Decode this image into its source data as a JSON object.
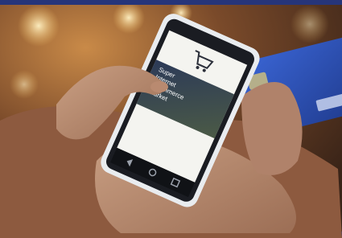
{
  "photo": {
    "subject": "hand-holding-smartphone-with-credit-card",
    "colors": {
      "background_warm": "#a0683a",
      "background_dark": "#3a2418",
      "phone_body": "#e9ecef",
      "phone_bezel": "#1a1c22",
      "screen_white": "#f4f4f0",
      "banner_dark": "#27324a",
      "card_blue": "#2e4fb4",
      "frame_blue": "#26357a"
    }
  },
  "screen": {
    "banner_text": [
      "Super",
      "Internet",
      "Ecommerce",
      "Market"
    ],
    "cart_icon": "shopping-cart-icon"
  }
}
